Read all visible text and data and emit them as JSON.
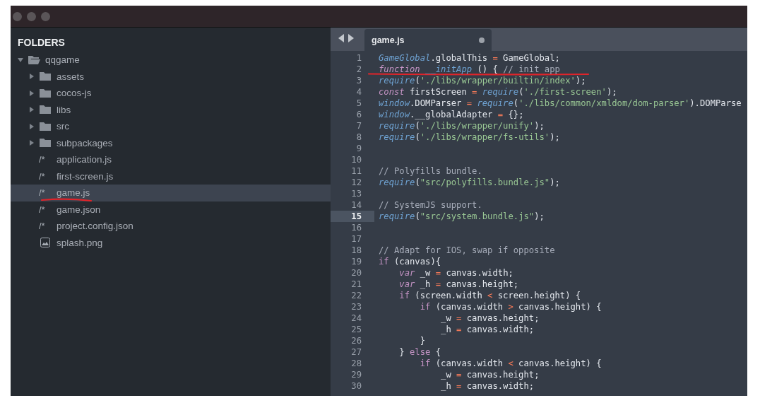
{
  "sidebar": {
    "heading": "FOLDERS",
    "tree": [
      {
        "name": "qqgame",
        "kind": "folder",
        "expanded": true,
        "selected": false,
        "underlined": false,
        "children": [
          {
            "name": "assets",
            "kind": "folder",
            "expanded": false,
            "selected": false,
            "underlined": false
          },
          {
            "name": "cocos-js",
            "kind": "folder",
            "expanded": false,
            "selected": false,
            "underlined": false
          },
          {
            "name": "libs",
            "kind": "folder",
            "expanded": false,
            "selected": false,
            "underlined": false
          },
          {
            "name": "src",
            "kind": "folder",
            "expanded": false,
            "selected": false,
            "underlined": false
          },
          {
            "name": "subpackages",
            "kind": "folder",
            "expanded": false,
            "selected": false,
            "underlined": false
          },
          {
            "name": "application.js",
            "kind": "file",
            "glyph": "/*",
            "selected": false,
            "underlined": false
          },
          {
            "name": "first-screen.js",
            "kind": "file",
            "glyph": "/*",
            "selected": false,
            "underlined": false
          },
          {
            "name": "game.js",
            "kind": "file",
            "glyph": "/*",
            "selected": true,
            "underlined": true
          },
          {
            "name": "game.json",
            "kind": "file",
            "glyph": "/*",
            "selected": false,
            "underlined": false
          },
          {
            "name": "project.config.json",
            "kind": "file",
            "glyph": "/*",
            "selected": false,
            "underlined": false
          },
          {
            "name": "splash.png",
            "kind": "image",
            "selected": false,
            "underlined": false
          }
        ]
      }
    ]
  },
  "tabs": [
    {
      "title": "game.js",
      "selected": true,
      "modified": true
    }
  ],
  "editor": {
    "lines": [
      {
        "n": "1",
        "current": false,
        "struck": false,
        "tokens": [
          {
            "kind": "fn",
            "text": "GameGlobal"
          },
          {
            "kind": "p",
            "text": ".globalThis "
          },
          {
            "kind": "op",
            "text": "="
          },
          {
            "kind": "p",
            "text": " GameGlobal;"
          }
        ]
      },
      {
        "n": "2",
        "current": false,
        "struck": true,
        "tokens": [
          {
            "kind": "kw",
            "text": "function "
          },
          {
            "kind": "fn",
            "text": "__initApp"
          },
          {
            "kind": "p",
            "text": " () { "
          },
          {
            "kind": "c",
            "text": "// init app"
          }
        ]
      },
      {
        "n": "3",
        "current": false,
        "struck": false,
        "tokens": [
          {
            "kind": "fn",
            "text": "require"
          },
          {
            "kind": "p",
            "text": "("
          },
          {
            "kind": "s",
            "text": "'./libs/wrapper/builtin/index'"
          },
          {
            "kind": "p",
            "text": ");"
          }
        ]
      },
      {
        "n": "4",
        "current": false,
        "struck": false,
        "tokens": [
          {
            "kind": "kw",
            "text": "const"
          },
          {
            "kind": "p",
            "text": " firstScreen "
          },
          {
            "kind": "op",
            "text": "="
          },
          {
            "kind": "fn",
            "text": " require"
          },
          {
            "kind": "p",
            "text": "("
          },
          {
            "kind": "s",
            "text": "'./first-screen'"
          },
          {
            "kind": "p",
            "text": ");"
          }
        ]
      },
      {
        "n": "5",
        "current": false,
        "struck": false,
        "tokens": [
          {
            "kind": "fn",
            "text": "window"
          },
          {
            "kind": "p",
            "text": ".DOMParser "
          },
          {
            "kind": "op",
            "text": "="
          },
          {
            "kind": "fn",
            "text": " require"
          },
          {
            "kind": "p",
            "text": "("
          },
          {
            "kind": "s",
            "text": "'./libs/common/xmldom/dom-parser'"
          },
          {
            "kind": "p",
            "text": ").DOMParse"
          }
        ]
      },
      {
        "n": "6",
        "current": false,
        "struck": false,
        "tokens": [
          {
            "kind": "fn",
            "text": "window"
          },
          {
            "kind": "p",
            "text": ".__globalAdapter "
          },
          {
            "kind": "op",
            "text": "="
          },
          {
            "kind": "p",
            "text": " {};"
          }
        ]
      },
      {
        "n": "7",
        "current": false,
        "struck": false,
        "tokens": [
          {
            "kind": "fn",
            "text": "require"
          },
          {
            "kind": "p",
            "text": "("
          },
          {
            "kind": "s",
            "text": "'./libs/wrapper/unify'"
          },
          {
            "kind": "p",
            "text": ");"
          }
        ]
      },
      {
        "n": "8",
        "current": false,
        "struck": false,
        "tokens": [
          {
            "kind": "fn",
            "text": "require"
          },
          {
            "kind": "p",
            "text": "("
          },
          {
            "kind": "s",
            "text": "'./libs/wrapper/fs-utils'"
          },
          {
            "kind": "p",
            "text": ");"
          }
        ]
      },
      {
        "n": "9",
        "current": false,
        "struck": false
      },
      {
        "n": "10",
        "current": false,
        "struck": false
      },
      {
        "n": "11",
        "current": false,
        "struck": false,
        "tokens": [
          {
            "kind": "c",
            "text": "// Polyfills bundle."
          }
        ]
      },
      {
        "n": "12",
        "current": false,
        "struck": false,
        "tokens": [
          {
            "kind": "fn",
            "text": "require"
          },
          {
            "kind": "p",
            "text": "("
          },
          {
            "kind": "s",
            "text": "\"src/polyfills.bundle.js\""
          },
          {
            "kind": "p",
            "text": ");"
          }
        ]
      },
      {
        "n": "13",
        "current": false,
        "struck": false
      },
      {
        "n": "14",
        "current": false,
        "struck": false,
        "tokens": [
          {
            "kind": "c",
            "text": "// SystemJS support."
          }
        ]
      },
      {
        "n": "15",
        "current": true,
        "struck": false,
        "tokens": [
          {
            "kind": "fn",
            "text": "require"
          },
          {
            "kind": "p",
            "text": "("
          },
          {
            "kind": "s",
            "text": "\"src/system.bundle.js\""
          },
          {
            "kind": "p",
            "text": ");"
          }
        ]
      },
      {
        "n": "16",
        "current": false,
        "struck": false
      },
      {
        "n": "17",
        "current": false,
        "struck": false
      },
      {
        "n": "18",
        "current": false,
        "struck": false,
        "tokens": [
          {
            "kind": "c",
            "text": "// Adapt for IOS, swap if opposite"
          }
        ]
      },
      {
        "n": "19",
        "current": false,
        "struck": false,
        "tokens": [
          {
            "kind": "ctl",
            "text": "if"
          },
          {
            "kind": "p",
            "text": " (canvas){"
          }
        ]
      },
      {
        "n": "20",
        "current": false,
        "struck": false,
        "tokens": [
          {
            "kind": "kw",
            "text": "    var"
          },
          {
            "kind": "p",
            "text": " _w "
          },
          {
            "kind": "op",
            "text": "="
          },
          {
            "kind": "p",
            "text": " canvas.width;"
          }
        ]
      },
      {
        "n": "21",
        "current": false,
        "struck": false,
        "tokens": [
          {
            "kind": "kw",
            "text": "    var"
          },
          {
            "kind": "p",
            "text": " _h "
          },
          {
            "kind": "op",
            "text": "="
          },
          {
            "kind": "p",
            "text": " canvas.height;"
          }
        ]
      },
      {
        "n": "22",
        "current": false,
        "struck": false,
        "tokens": [
          {
            "kind": "ctl",
            "text": "    if"
          },
          {
            "kind": "p",
            "text": " (screen.width "
          },
          {
            "kind": "op",
            "text": "<"
          },
          {
            "kind": "p",
            "text": " screen.height) {"
          }
        ]
      },
      {
        "n": "23",
        "current": false,
        "struck": false,
        "tokens": [
          {
            "kind": "ctl",
            "text": "        if"
          },
          {
            "kind": "p",
            "text": " (canvas.width "
          },
          {
            "kind": "op",
            "text": ">"
          },
          {
            "kind": "p",
            "text": " canvas.height) {"
          }
        ]
      },
      {
        "n": "24",
        "current": false,
        "struck": false,
        "tokens": [
          {
            "kind": "p",
            "text": "            _w "
          },
          {
            "kind": "op",
            "text": "="
          },
          {
            "kind": "p",
            "text": " canvas.height;"
          }
        ]
      },
      {
        "n": "25",
        "current": false,
        "struck": false,
        "tokens": [
          {
            "kind": "p",
            "text": "            _h "
          },
          {
            "kind": "op",
            "text": "="
          },
          {
            "kind": "p",
            "text": " canvas.width;"
          }
        ]
      },
      {
        "n": "26",
        "current": false,
        "struck": false,
        "tokens": [
          {
            "kind": "p",
            "text": "        }"
          }
        ]
      },
      {
        "n": "27",
        "current": false,
        "struck": false,
        "tokens": [
          {
            "kind": "p",
            "text": "    } "
          },
          {
            "kind": "ctl",
            "text": "else"
          },
          {
            "kind": "p",
            "text": " {"
          }
        ]
      },
      {
        "n": "28",
        "current": false,
        "struck": false,
        "tokens": [
          {
            "kind": "ctl",
            "text": "        if"
          },
          {
            "kind": "p",
            "text": " (canvas.width "
          },
          {
            "kind": "op",
            "text": "<"
          },
          {
            "kind": "p",
            "text": " canvas.height) {"
          }
        ]
      },
      {
        "n": "29",
        "current": false,
        "struck": false,
        "tokens": [
          {
            "kind": "p",
            "text": "            _w "
          },
          {
            "kind": "op",
            "text": "="
          },
          {
            "kind": "p",
            "text": " canvas.height;"
          }
        ]
      },
      {
        "n": "30",
        "current": false,
        "struck": false,
        "tokens": [
          {
            "kind": "p",
            "text": "            _h "
          },
          {
            "kind": "op",
            "text": "="
          },
          {
            "kind": "p",
            "text": " canvas.width;"
          }
        ]
      }
    ]
  }
}
